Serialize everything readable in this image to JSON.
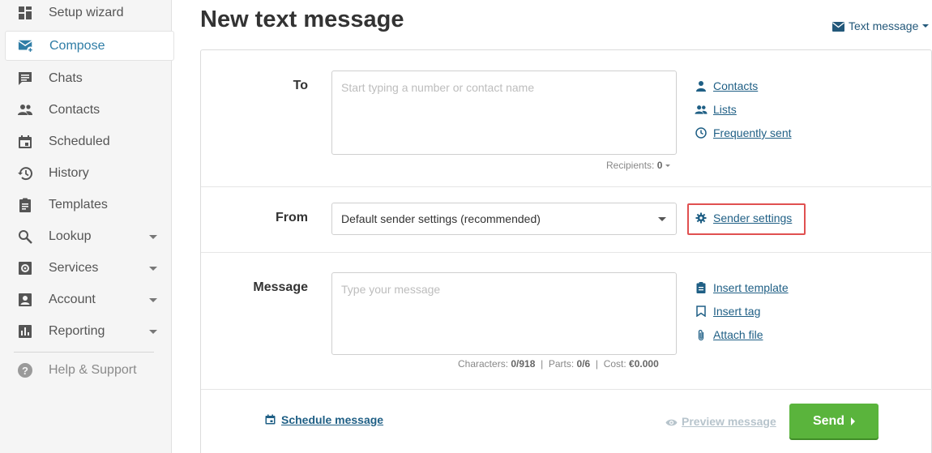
{
  "sidebar": {
    "items": [
      {
        "label": "Setup wizard",
        "icon": "dashboard-icon"
      },
      {
        "label": "Compose",
        "icon": "compose-mail-icon",
        "active": true
      },
      {
        "label": "Chats",
        "icon": "chat-icon"
      },
      {
        "label": "Contacts",
        "icon": "people-icon"
      },
      {
        "label": "Scheduled",
        "icon": "calendar-icon"
      },
      {
        "label": "History",
        "icon": "history-icon"
      },
      {
        "label": "Templates",
        "icon": "clipboard-icon"
      },
      {
        "label": "Lookup",
        "icon": "search-icon",
        "expandable": true
      },
      {
        "label": "Services",
        "icon": "gear-box-icon",
        "expandable": true
      },
      {
        "label": "Account",
        "icon": "account-box-icon",
        "expandable": true
      },
      {
        "label": "Reporting",
        "icon": "bar-chart-icon",
        "expandable": true
      },
      {
        "label": "Help & Support",
        "icon": "help-icon"
      }
    ]
  },
  "header": {
    "title": "New text message",
    "type_switch": "Text message"
  },
  "form": {
    "to": {
      "label": "To",
      "placeholder": "Start typing a number or contact name",
      "recipients_label": "Recipients:",
      "recipients_count": "0",
      "links": [
        "Contacts",
        "Lists",
        "Frequently sent"
      ]
    },
    "from": {
      "label": "From",
      "selected": "Default sender settings (recommended)",
      "link": "Sender settings"
    },
    "message": {
      "label": "Message",
      "placeholder": "Type your message",
      "characters_label": "Characters:",
      "characters": "0/918",
      "parts_label": "Parts:",
      "parts": "0/6",
      "cost_label": "Cost:",
      "cost": "€0.000",
      "links": [
        "Insert template",
        "Insert tag",
        "Attach file"
      ]
    }
  },
  "footer": {
    "schedule": "Schedule message",
    "preview": "Preview message",
    "send": "Send"
  },
  "colors": {
    "accent": "#2f7da6",
    "link": "#1f5f85",
    "send": "#5ab43c",
    "highlight": "#e05050"
  }
}
